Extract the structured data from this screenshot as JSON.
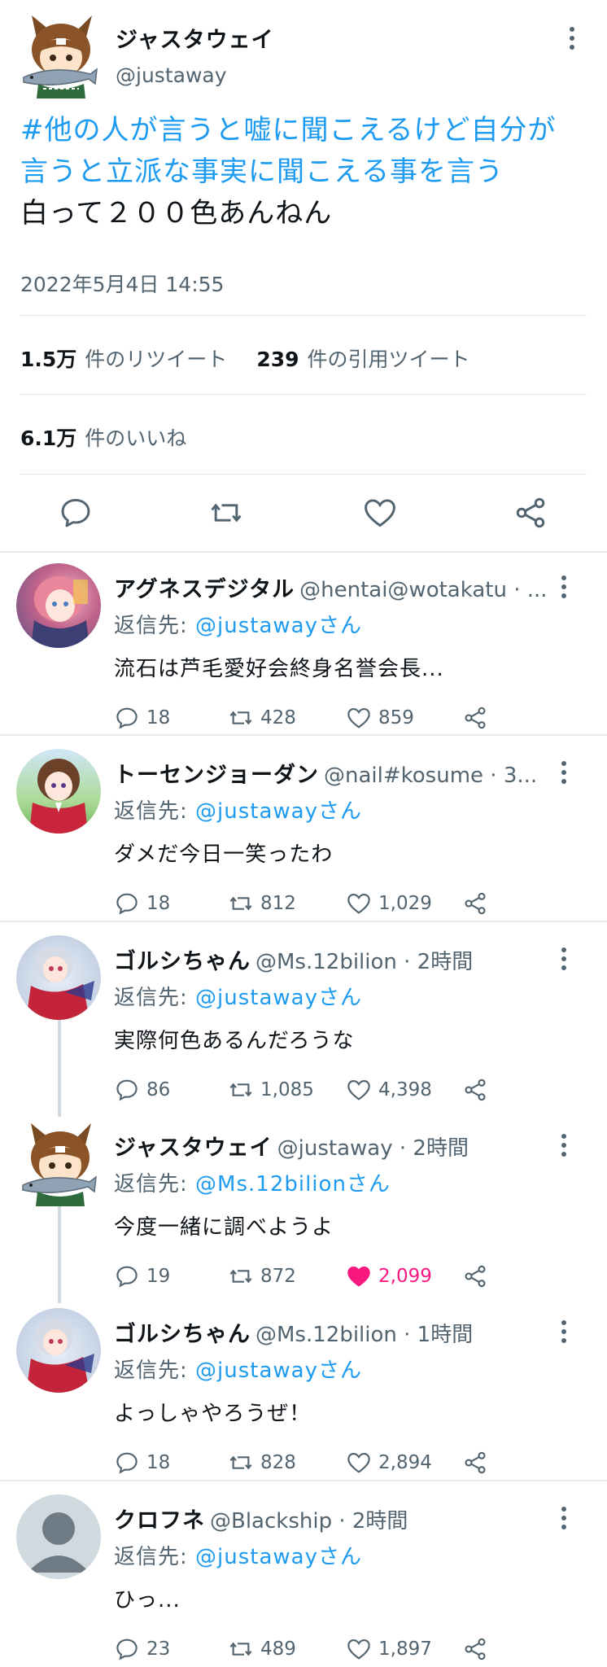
{
  "tweet": {
    "author_name": "ジャスタウェイ",
    "author_handle": "@justaway",
    "hashtag_line1": "#他の人が言うと嘘に聞こえるけど自分が",
    "hashtag_line2": "言うと立派な事実に聞こえる事を言う",
    "body": "白って２００色あんねん",
    "date": "2022年5月4日 14:55",
    "retweets_count": "1.5万",
    "retweets_label": "件のリツイート",
    "quotes_count": "239",
    "quotes_label": "件の引用ツイート",
    "likes_count": "6.1万",
    "likes_label": "件のいいね",
    "action_icons": [
      "reply-icon",
      "retweet-icon",
      "like-icon",
      "share-icon"
    ]
  },
  "replies": [
    {
      "name": "アグネスデジタル",
      "meta": "@hentai@wotakatu · ...",
      "reply_prefix": "返信先: ",
      "reply_to": "@justawayさん",
      "text": "流石は芦毛愛好会終身名誉会長...",
      "replies": "18",
      "retweets": "428",
      "likes": "859",
      "liked": false
    },
    {
      "name": "トーセンジョーダン",
      "meta": "@nail#kosume · 3...",
      "reply_prefix": "返信先: ",
      "reply_to": "@justawayさん",
      "text": "ダメだ今日一笑ったわ",
      "replies": "18",
      "retweets": "812",
      "likes": "1,029",
      "liked": false
    },
    {
      "name": "ゴルシちゃん",
      "meta": "@Ms.12bilion · 2時間",
      "reply_prefix": "返信先: ",
      "reply_to": "@justawayさん",
      "text": "実際何色あるんだろうな",
      "replies": "86",
      "retweets": "1,085",
      "likes": "4,398",
      "liked": false
    },
    {
      "name": "ジャスタウェイ",
      "meta": "@justaway · 2時間",
      "reply_prefix": "返信先: ",
      "reply_to": "@Ms.12bilionさん",
      "text": "今度一緒に調べようよ",
      "replies": "19",
      "retweets": "872",
      "likes": "2,099",
      "liked": true
    },
    {
      "name": "ゴルシちゃん",
      "meta": "@Ms.12bilion · 1時間",
      "reply_prefix": "返信先: ",
      "reply_to": "@justawayさん",
      "text": "よっしゃやろうぜ！",
      "replies": "18",
      "retweets": "828",
      "likes": "2,894",
      "liked": false
    },
    {
      "name": "クロフネ",
      "meta": "@Blackship · 2時間",
      "reply_prefix": "返信先: ",
      "reply_to": "@justawayさん",
      "text": "ひっ...",
      "replies": "23",
      "retweets": "489",
      "likes": "1,897",
      "liked": false
    }
  ],
  "colors": {
    "accent": "#1d9bf0",
    "like_active": "#f91880",
    "secondary_text": "#536471",
    "divider": "#e7ebee"
  }
}
